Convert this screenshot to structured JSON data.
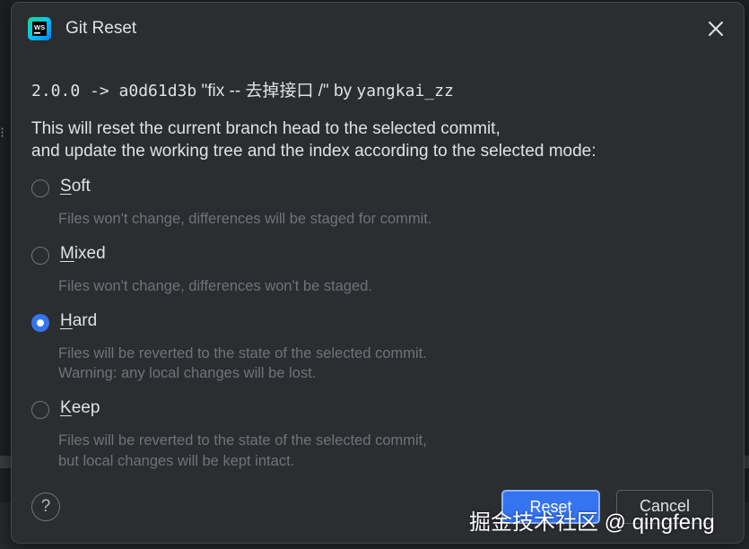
{
  "window": {
    "title": "Git Reset",
    "app_icon_text": "WS"
  },
  "commit": {
    "range": "2.0.0 -> a0d61d3b",
    "message": "\"fix -- 去掉接口 /\"",
    "by": "by",
    "author": "yangkai_zz"
  },
  "description": {
    "line1": "This will reset the current branch head to the selected commit,",
    "line2": "and update the working tree and the index according to the selected mode:"
  },
  "options": [
    {
      "mnemonic": "S",
      "rest": "oft",
      "checked": false,
      "desc1": "Files won't change, differences will be staged for commit.",
      "desc2": ""
    },
    {
      "mnemonic": "M",
      "rest": "ixed",
      "checked": false,
      "desc1": "Files won't change, differences won't be staged.",
      "desc2": ""
    },
    {
      "mnemonic": "H",
      "rest": "ard",
      "checked": true,
      "desc1": "Files will be reverted to the state of the selected commit.",
      "desc2": "Warning: any local changes will be lost."
    },
    {
      "mnemonic": "K",
      "rest": "eep",
      "checked": false,
      "desc1": "Files will be reverted to the state of the selected commit,",
      "desc2": "but local changes will be kept intact."
    }
  ],
  "help": {
    "label": "?"
  },
  "buttons": {
    "reset": "Reset",
    "cancel": "Cancel"
  },
  "watermark": "掘金技术社区 @ qingfeng",
  "colors": {
    "dialog_bg": "#2b2d30",
    "accent": "#3574f0",
    "text": "#dfe1e5",
    "muted_text": "#6f737a"
  }
}
